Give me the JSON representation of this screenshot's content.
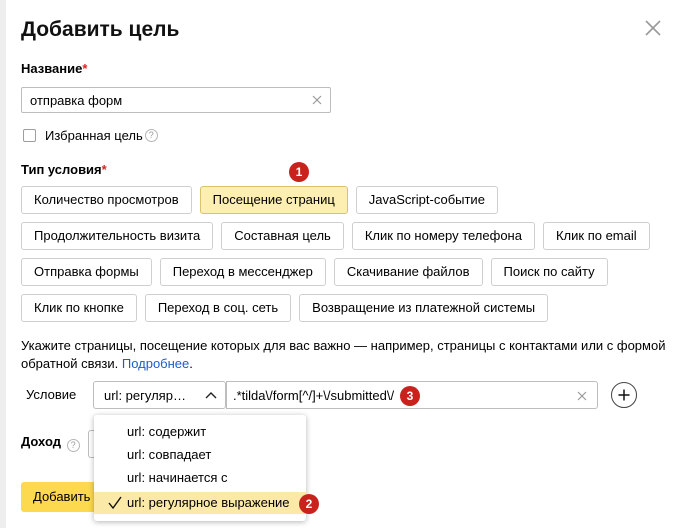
{
  "dialog": {
    "title": "Добавить цель",
    "close_label": "×"
  },
  "name_section": {
    "label": "Название",
    "required_mark": "*",
    "value": "отправка форм"
  },
  "favorite": {
    "label": "Избранная цель",
    "help": "?"
  },
  "condition_type": {
    "label": "Тип условия",
    "required_mark": "*",
    "rows": [
      [
        "Количество просмотров",
        "Посещение страниц",
        "JavaScript-событие"
      ],
      [
        "Продолжительность визита",
        "Составная цель",
        "Клик по номеру телефона",
        "Клик по email"
      ],
      [
        "Отправка формы",
        "Переход в мессенджер",
        "Скачивание файлов",
        "Поиск по сайту"
      ],
      [
        "Клик по кнопке",
        "Переход в соц. сеть",
        "Возвращение из платежной системы"
      ]
    ],
    "active": "Посещение страниц"
  },
  "description": {
    "text": "Укажите страницы, посещение которых для вас важно — например, страницы с контактами или с формой обратной связи. ",
    "link": "Подробнее",
    "tail": "."
  },
  "condition": {
    "label": "Условие",
    "selected": "url: регуляр…",
    "pattern": ".*tilda\\/form[^/]+\\/submitted\\/",
    "add": "+"
  },
  "income": {
    "label": "Доход",
    "help": "?"
  },
  "add_button": {
    "label": "Добавить цель"
  },
  "dropdown": {
    "options": [
      "url: содержит",
      "url: совпадает",
      "url: начинается с",
      "url: регулярное выражение"
    ],
    "selected_index": 3
  },
  "badges": [
    "1",
    "2",
    "3"
  ],
  "colors": {
    "accent_yellow": "#fcd94e",
    "chip_active": "#fdefb2",
    "badge_red": "#c9221d",
    "link_blue": "#1a5fc4",
    "required_red": "#e02020"
  }
}
